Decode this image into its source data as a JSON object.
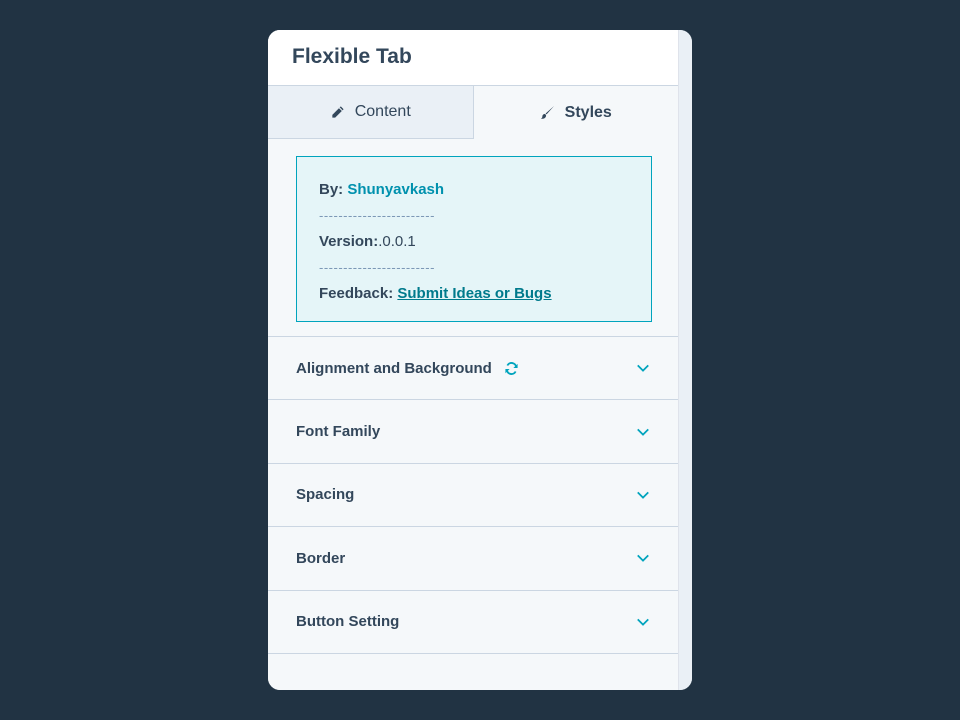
{
  "header": {
    "title": "Flexible Tab"
  },
  "tabs": [
    {
      "label": "Content",
      "icon": "pencil-icon"
    },
    {
      "label": "Styles",
      "icon": "brush-icon"
    }
  ],
  "info": {
    "by_label": "By:",
    "author": "Shunyavkash",
    "separator": "------------------------",
    "version_label": "Version:",
    "version_value": ".0.0.1",
    "feedback_label": "Feedback:",
    "feedback_link": "Submit Ideas or Bugs"
  },
  "sections": [
    {
      "label": "Alignment and Background",
      "has_refresh": true
    },
    {
      "label": "Font Family"
    },
    {
      "label": "Spacing"
    },
    {
      "label": "Border"
    },
    {
      "label": "Button Setting"
    }
  ],
  "colors": {
    "accent": "#00a4bd",
    "text": "#33475b",
    "background": "#213343"
  }
}
